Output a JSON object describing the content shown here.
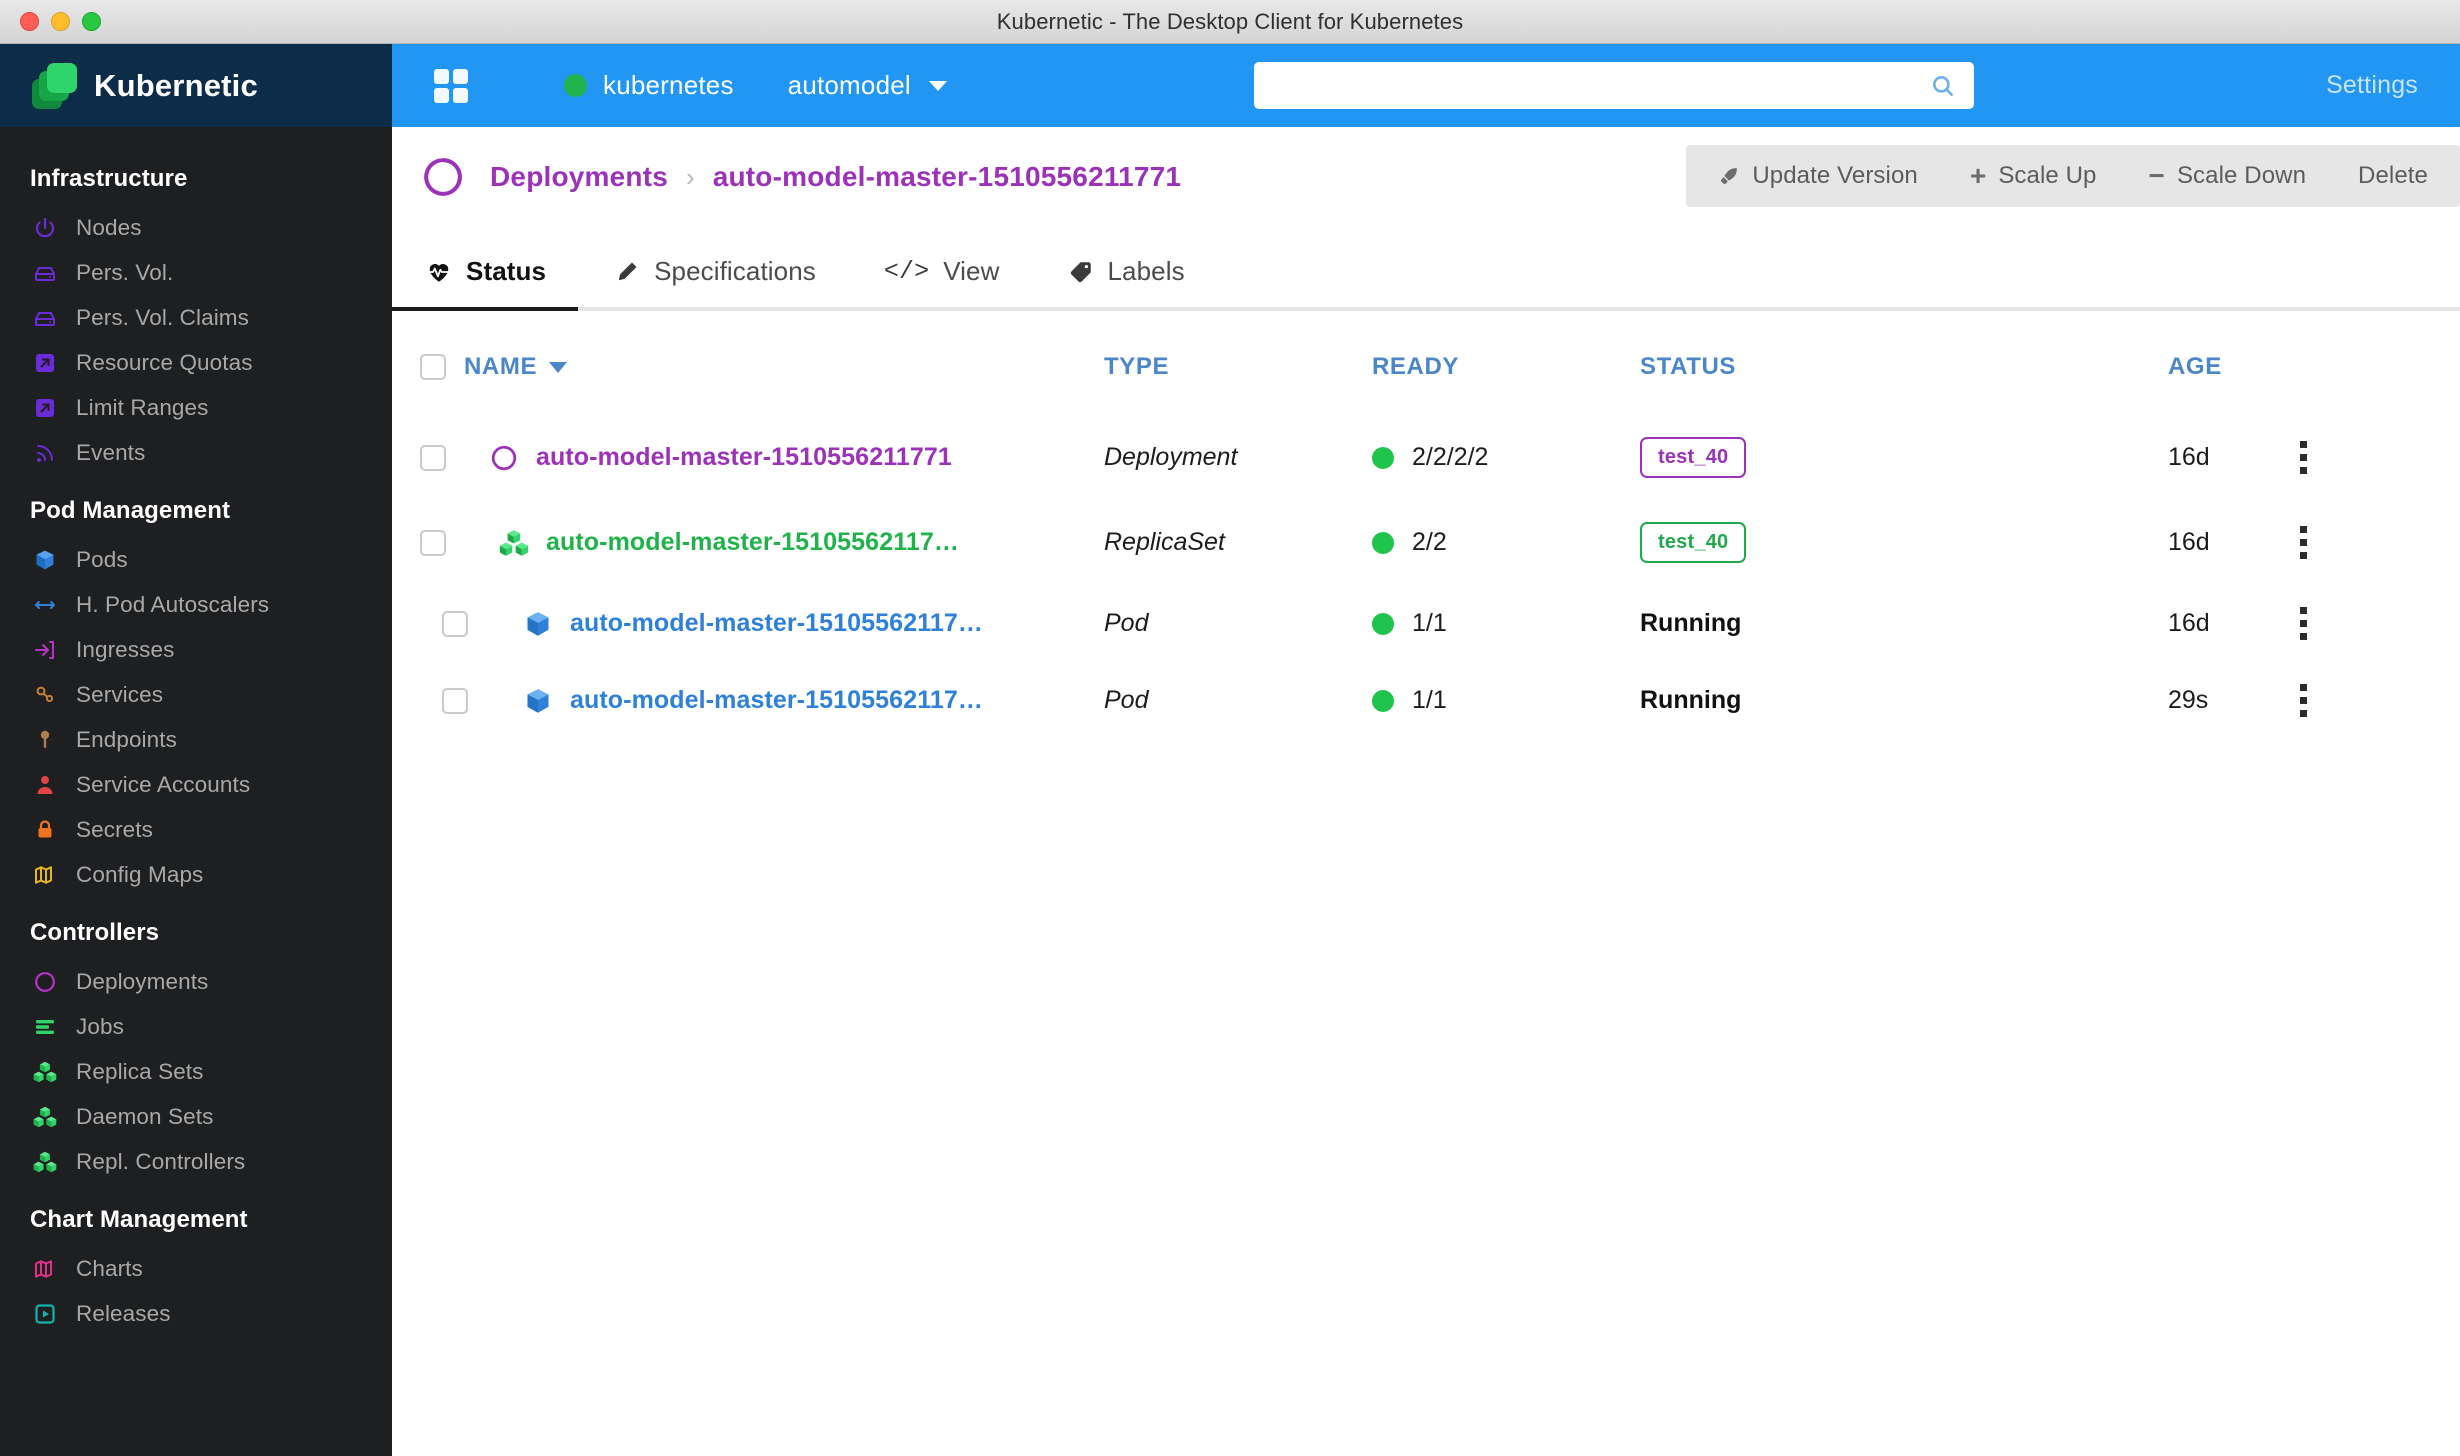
{
  "window": {
    "title": "Kubernetic - The Desktop Client for Kubernetes"
  },
  "brand": {
    "name": "Kubernetic"
  },
  "topbar": {
    "cluster": "kubernetes",
    "namespace": "automodel",
    "search_value": "",
    "search_placeholder": "",
    "settings_label": "Settings"
  },
  "sidebar": {
    "sections": [
      {
        "title": "Infrastructure",
        "items": [
          {
            "label": "Nodes",
            "icon": "power-icon",
            "color": "#6c2bd9"
          },
          {
            "label": "Pers. Vol.",
            "icon": "hdd-icon",
            "color": "#6c2bd9"
          },
          {
            "label": "Pers. Vol. Claims",
            "icon": "hdd-icon",
            "color": "#6c2bd9"
          },
          {
            "label": "Resource Quotas",
            "icon": "arrow-square-icon",
            "color": "#6c2bd9"
          },
          {
            "label": "Limit Ranges",
            "icon": "arrow-square-icon",
            "color": "#6c2bd9"
          },
          {
            "label": "Events",
            "icon": "rss-icon",
            "color": "#6c2bd9"
          }
        ]
      },
      {
        "title": "Pod Management",
        "items": [
          {
            "label": "Pods",
            "icon": "cube-icon",
            "color": "#2f80d8"
          },
          {
            "label": "H. Pod Autoscalers",
            "icon": "arrows-horizontal-icon",
            "color": "#2f80d8"
          },
          {
            "label": "Ingresses",
            "icon": "sign-in-icon",
            "color": "#b832c8"
          },
          {
            "label": "Services",
            "icon": "chain-icon",
            "color": "#c87f32"
          },
          {
            "label": "Endpoints",
            "icon": "pin-icon",
            "color": "#b07a4a"
          },
          {
            "label": "Service Accounts",
            "icon": "user-icon",
            "color": "#e04343"
          },
          {
            "label": "Secrets",
            "icon": "lock-icon",
            "color": "#f07420"
          },
          {
            "label": "Config Maps",
            "icon": "map-icon",
            "color": "#e8b518"
          }
        ]
      },
      {
        "title": "Controllers",
        "items": [
          {
            "label": "Deployments",
            "icon": "ring-icon",
            "color": "#b832c8"
          },
          {
            "label": "Jobs",
            "icon": "lines-icon",
            "color": "#2fd46a"
          },
          {
            "label": "Replica Sets",
            "icon": "cubes-icon",
            "color": "#2fd46a"
          },
          {
            "label": "Daemon Sets",
            "icon": "cubes-icon",
            "color": "#2fd46a"
          },
          {
            "label": "Repl. Controllers",
            "icon": "cubes-icon",
            "color": "#2fd46a"
          }
        ]
      },
      {
        "title": "Chart Management",
        "items": [
          {
            "label": "Charts",
            "icon": "map-icon",
            "color": "#e0318a"
          },
          {
            "label": "Releases",
            "icon": "play-square-icon",
            "color": "#12b5ae"
          }
        ]
      }
    ]
  },
  "breadcrumb": {
    "parent": "Deployments",
    "separator": "›",
    "current": "auto-model-master-1510556211771"
  },
  "actions": [
    {
      "label": "Update Version",
      "icon": "rocket-icon"
    },
    {
      "label": "Scale Up",
      "icon": "plus-icon"
    },
    {
      "label": "Scale Down",
      "icon": "minus-icon"
    },
    {
      "label": "Delete",
      "icon": "none"
    }
  ],
  "tabs": [
    {
      "label": "Status",
      "icon": "heartbeat-icon",
      "active": true
    },
    {
      "label": "Specifications",
      "icon": "pencil-icon",
      "active": false
    },
    {
      "label": "View",
      "icon": "code-icon",
      "active": false
    },
    {
      "label": "Labels",
      "icon": "tag-icon",
      "active": false
    }
  ],
  "table": {
    "headers": {
      "name": "NAME",
      "type": "TYPE",
      "ready": "READY",
      "status": "STATUS",
      "age": "AGE"
    },
    "sort_column": "NAME",
    "sort_direction": "desc",
    "rows": [
      {
        "name": "auto-model-master-1510556211771",
        "icon": "ring-icon",
        "color": "purple",
        "indent": 0,
        "type": "Deployment",
        "ready": "2/2/2/2",
        "ready_state": "ok",
        "status": "test_40",
        "status_kind": "badge-purple",
        "age": "16d"
      },
      {
        "name": "auto-model-master-15105562117…",
        "icon": "cubes-icon",
        "color": "green",
        "indent": 1,
        "type": "ReplicaSet",
        "ready": "2/2",
        "ready_state": "ok",
        "status": "test_40",
        "status_kind": "badge-green",
        "age": "16d"
      },
      {
        "name": "auto-model-master-15105562117…",
        "icon": "cube-icon",
        "color": "blue",
        "indent": 2,
        "type": "Pod",
        "ready": "1/1",
        "ready_state": "ok",
        "status": "Running",
        "status_kind": "text",
        "age": "16d"
      },
      {
        "name": "auto-model-master-15105562117…",
        "icon": "cube-icon",
        "color": "blue",
        "indent": 2,
        "type": "Pod",
        "ready": "1/1",
        "ready_state": "ok",
        "status": "Running",
        "status_kind": "text",
        "age": "29s"
      }
    ]
  },
  "colors": {
    "topbar_blue": "#2196f3",
    "sidebar_dark": "#1e1f21",
    "sidebar_header": "#0d2c47",
    "accent_purple": "#9b32b8",
    "accent_green": "#22b24c",
    "accent_blue": "#2f80d8",
    "header_blue": "#4a86c8"
  }
}
